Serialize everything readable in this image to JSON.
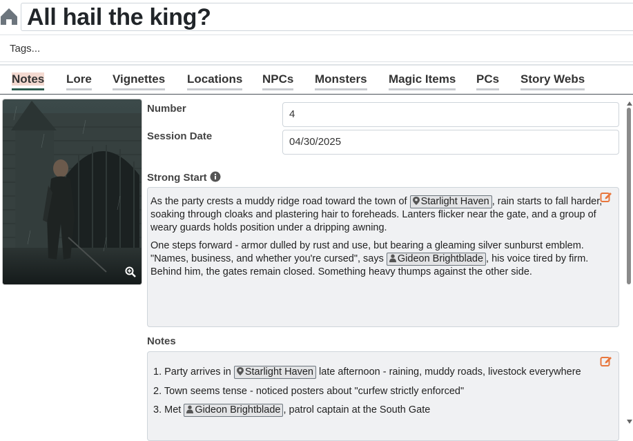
{
  "header": {
    "title": "All hail the king?",
    "home_icon": "home-icon"
  },
  "tags": {
    "placeholder": "Tags..."
  },
  "tabs": [
    {
      "label": "Notes",
      "active": true
    },
    {
      "label": "Lore"
    },
    {
      "label": "Vignettes"
    },
    {
      "label": "Locations"
    },
    {
      "label": "NPCs"
    },
    {
      "label": "Monsters"
    },
    {
      "label": "Magic Items"
    },
    {
      "label": "PCs"
    },
    {
      "label": "Story Webs"
    }
  ],
  "fields": {
    "number_label": "Number",
    "number_value": "4",
    "session_date_label": "Session Date",
    "session_date_value": "04/30/2025"
  },
  "strong_start": {
    "label": "Strong Start",
    "p1": {
      "before": "As the party crests a muddy ridge road toward the town of ",
      "chip": "Starlight Haven",
      "after": ", rain starts to fall harder, soaking through cloaks and plastering hair to foreheads. Lanters flicker near the gate, and a group of weary guards holds position under a dripping awning."
    },
    "p2": {
      "before": "One steps forward - armor dulled by rust and use, but bearing a gleaming silver sunburst emblem. \"Names, business, and whether you're cursed\", says ",
      "chip": "Gideon Brightblade",
      "after": ", his voice tired by firm. Behind him, the gates remain closed. Something heavy thumps against the other side."
    }
  },
  "notes": {
    "label": "Notes",
    "items": [
      {
        "num": "1.",
        "before": "Party arrives in ",
        "chip": "Starlight Haven",
        "chip_type": "location",
        "after": " late afternoon - raining, muddy roads, livestock everywhere"
      },
      {
        "num": "2.",
        "before": "Town seems tense - noticed posters about \"curfew strictly enforced\"",
        "chip": "",
        "chip_type": "",
        "after": ""
      },
      {
        "num": "3.",
        "before": "Met ",
        "chip": "Gideon Brightblade",
        "chip_type": "npc",
        "after": ", patrol captain at the South Gate"
      }
    ]
  },
  "colors": {
    "accent": "#e8763c",
    "active_tab": "#2f5d50",
    "chip_border": "#6c757d",
    "panel_bg": "#f0f1f3"
  }
}
